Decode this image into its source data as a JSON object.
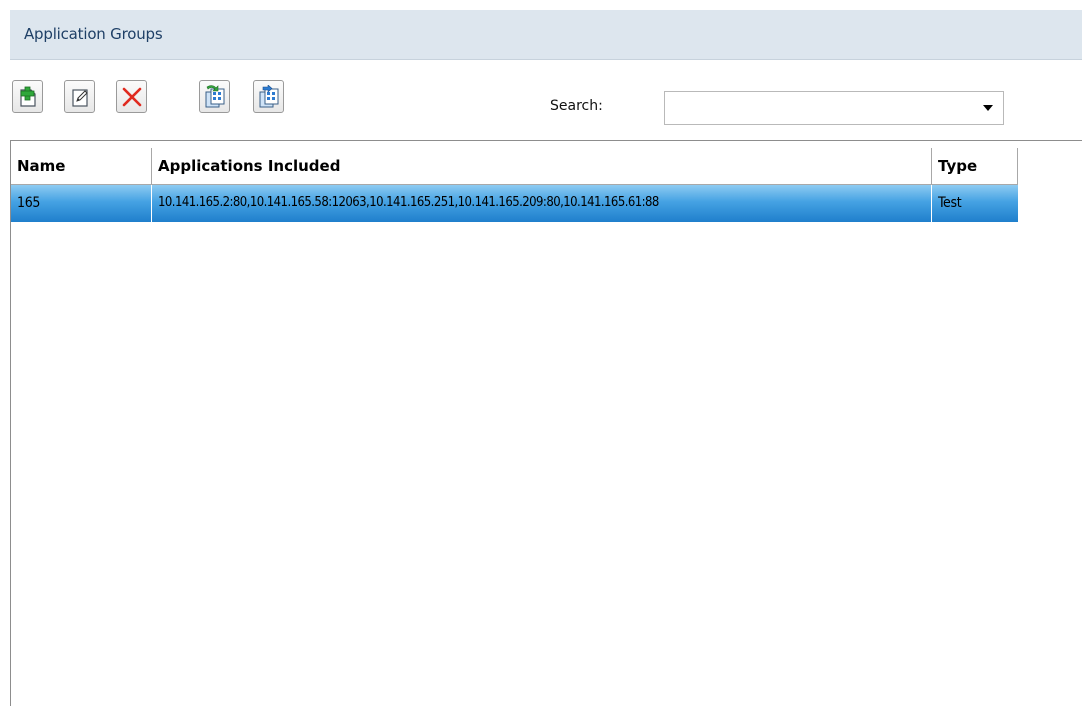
{
  "header": {
    "title": "Application Groups"
  },
  "toolbar": {
    "buttons": [
      {
        "name": "add-group-button",
        "icon": "add-document-icon"
      },
      {
        "name": "edit-group-button",
        "icon": "edit-document-icon"
      },
      {
        "name": "delete-group-button",
        "icon": "delete-x-icon"
      },
      {
        "name": "import-button",
        "icon": "import-icon"
      },
      {
        "name": "export-button",
        "icon": "export-icon"
      }
    ],
    "search_label": "Search:",
    "search_value": ""
  },
  "table": {
    "columns": [
      "Name",
      "Applications Included",
      "Type"
    ],
    "rows": [
      {
        "name": "165",
        "applications": "10.141.165.2:80,10.141.165.58:12063,10.141.165.251,10.141.165.209:80,10.141.165.61:88",
        "type": "Test",
        "selected": true
      }
    ]
  },
  "colors": {
    "title_bar_bg": "#dde6ee",
    "title_text": "#1e3f66",
    "selection_top": "#8ecbf2",
    "selection_bottom": "#1f7fcc",
    "delete_red": "#e02a1f"
  }
}
